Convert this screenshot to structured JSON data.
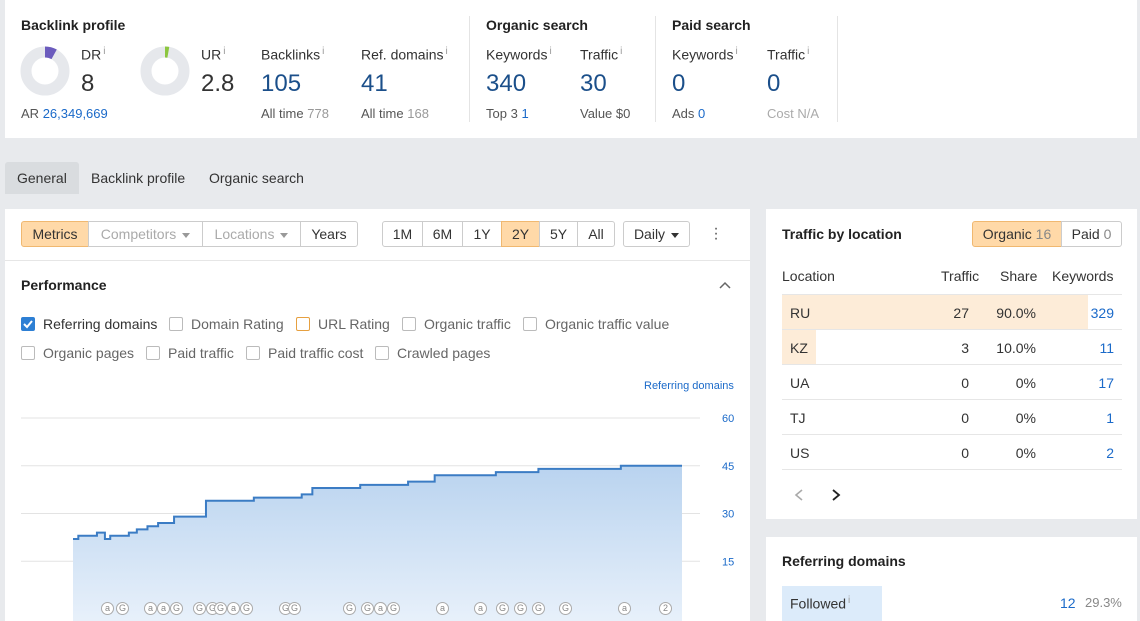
{
  "summary": {
    "backlink_profile": {
      "title": "Backlink profile",
      "dr_label": "DR",
      "dr_value": "8",
      "ar_label": "AR",
      "ar_value": "26,349,669",
      "ur_label": "UR",
      "ur_value": "2.8",
      "backlinks_label": "Backlinks",
      "backlinks_value": "105",
      "backlinks_alltime_label": "All time",
      "backlinks_alltime_value": "778",
      "refdomains_label": "Ref. domains",
      "refdomains_value": "41",
      "refdomains_alltime_label": "All time",
      "refdomains_alltime_value": "168",
      "info_mark": "i"
    },
    "organic_search": {
      "title": "Organic search",
      "keywords_label": "Keywords",
      "keywords_value": "340",
      "top3_label": "Top 3",
      "top3_value": "1",
      "traffic_label": "Traffic",
      "traffic_value": "30",
      "value_label": "Value",
      "value_value": "$0"
    },
    "paid_search": {
      "title": "Paid search",
      "keywords_label": "Keywords",
      "keywords_value": "0",
      "ads_label": "Ads",
      "ads_value": "0",
      "traffic_label": "Traffic",
      "traffic_value": "0",
      "cost_label": "Cost",
      "cost_value": "N/A"
    }
  },
  "tabs": [
    "General",
    "Backlink profile",
    "Organic search"
  ],
  "toolbar": {
    "metrics": "Metrics",
    "competitors": "Competitors",
    "locations": "Locations",
    "years": "Years",
    "ranges": [
      "1M",
      "6M",
      "1Y",
      "2Y",
      "5Y",
      "All"
    ],
    "active_range": "2Y",
    "granularity": "Daily"
  },
  "performance": {
    "title": "Performance",
    "checkboxes": [
      {
        "label": "Referring domains",
        "checked": true
      },
      {
        "label": "Domain Rating",
        "checked": false
      },
      {
        "label": "URL Rating",
        "checked": false
      },
      {
        "label": "Organic traffic",
        "checked": false
      },
      {
        "label": "Organic traffic value",
        "checked": false
      },
      {
        "label": "Organic pages",
        "checked": false
      },
      {
        "label": "Paid traffic",
        "checked": false
      },
      {
        "label": "Paid traffic cost",
        "checked": false
      },
      {
        "label": "Crawled pages",
        "checked": false
      }
    ],
    "series_label": "Referring domains",
    "y_ticks": [
      "60",
      "45",
      "30",
      "15"
    ]
  },
  "chart_data": {
    "type": "area",
    "series": [
      {
        "name": "Referring domains",
        "values": [
          22,
          22,
          23,
          23,
          23,
          23,
          23,
          23,
          23,
          24,
          24,
          24,
          22,
          22,
          23,
          23,
          23,
          23,
          23,
          23,
          23,
          24,
          24,
          24,
          25,
          25,
          25,
          25,
          26,
          26,
          26,
          26,
          27,
          27,
          27,
          27,
          27,
          27,
          29,
          29,
          29,
          29,
          29,
          29,
          29,
          29,
          29,
          29,
          29,
          29,
          34,
          34,
          34,
          34,
          34,
          34,
          34,
          34,
          34,
          34,
          34,
          34,
          34,
          34,
          34,
          34,
          34,
          34,
          35,
          35,
          35,
          35,
          35,
          35,
          35,
          35,
          35,
          35,
          35,
          35,
          35,
          35,
          35,
          35,
          35,
          35,
          36,
          36,
          36,
          36,
          38,
          38,
          38,
          38,
          38,
          38,
          38,
          38,
          38,
          38,
          38,
          38,
          38,
          38,
          38,
          38,
          38,
          38,
          39,
          39,
          39,
          39,
          39,
          39,
          39,
          39,
          39,
          39,
          39,
          39,
          39,
          39,
          39,
          39,
          39,
          39,
          40,
          40,
          40,
          40,
          40,
          40,
          40,
          40,
          40,
          40,
          42,
          42,
          42,
          42,
          42,
          42,
          42,
          42,
          42,
          42,
          42,
          42,
          42,
          42,
          42,
          42,
          42,
          42,
          42,
          42,
          42,
          42,
          42,
          43,
          43,
          43,
          43,
          43,
          43,
          43,
          43,
          43,
          43,
          43,
          43,
          43,
          43,
          43,
          43,
          44,
          44,
          44,
          44,
          44,
          44,
          44,
          44,
          44,
          44,
          44,
          44,
          44,
          44,
          44,
          44,
          44,
          44,
          44,
          44,
          44,
          44,
          44,
          44,
          44,
          44,
          44,
          44,
          44,
          44,
          44,
          45,
          45,
          45,
          45,
          45,
          45,
          45,
          45,
          45,
          45,
          45,
          45,
          45,
          45,
          45,
          45,
          45,
          45,
          45,
          45,
          45,
          45,
          45,
          45
        ]
      }
    ],
    "ylim": [
      0,
      60
    ],
    "y_ticks": [
      15,
      30,
      45,
      60
    ]
  },
  "traffic_by_location": {
    "title": "Traffic by location",
    "organic_label": "Organic",
    "organic_count": "16",
    "paid_label": "Paid",
    "paid_count": "0",
    "headers": [
      "Location",
      "Traffic",
      "Share",
      "Keywords"
    ],
    "rows": [
      {
        "loc": "RU",
        "traffic": "27",
        "share": "90.0%",
        "keywords": "329",
        "share_fraction": 0.9
      },
      {
        "loc": "KZ",
        "traffic": "3",
        "share": "10.0%",
        "keywords": "11",
        "share_fraction": 0.1
      },
      {
        "loc": "UA",
        "traffic": "0",
        "share": "0%",
        "keywords": "17",
        "share_fraction": 0
      },
      {
        "loc": "TJ",
        "traffic": "0",
        "share": "0%",
        "keywords": "1",
        "share_fraction": 0
      },
      {
        "loc": "US",
        "traffic": "0",
        "share": "0%",
        "keywords": "2",
        "share_fraction": 0
      }
    ]
  },
  "referring_domains_panel": {
    "title": "Referring domains",
    "followed_label": "Followed",
    "followed_value": "12",
    "followed_share": "29.3%",
    "followed_fraction": 0.293
  },
  "colors": {
    "accent_orange": "#ffd9a8",
    "link_blue": "#1b6ac9",
    "chart_line": "#3b7cc4",
    "dr_purple": "#6b5bbd",
    "ur_green": "#8cc63f"
  }
}
